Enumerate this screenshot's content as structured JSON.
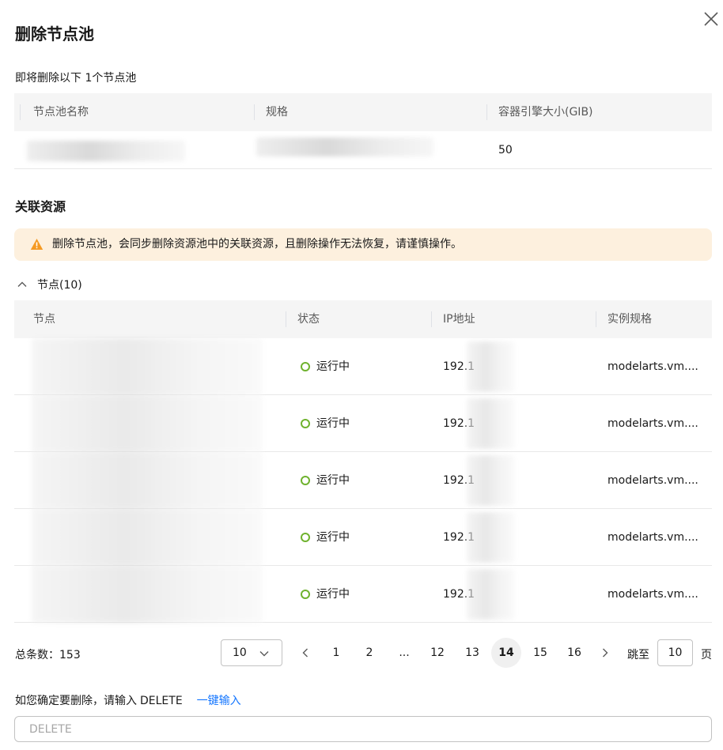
{
  "dialog": {
    "title": "删除节点池",
    "intro": "即将删除以下 1个节点池"
  },
  "pool_table": {
    "headers": [
      "节点池名称",
      "规格",
      "容器引擎大小(GIB)"
    ],
    "rows": [
      {
        "engine_size": "50"
      }
    ]
  },
  "related": {
    "title": "关联资源",
    "alert": "删除节点池，会同步删除资源池中的关联资源，且删除操作无法恢复，请谨慎操作。",
    "nodes_label": "节点(10)"
  },
  "node_table": {
    "headers": [
      "节点",
      "状态",
      "IP地址",
      "实例规格"
    ],
    "rows": [
      {
        "status": "运行中",
        "ip": "192.1",
        "spec": "modelarts.vm...."
      },
      {
        "status": "运行中",
        "ip": "192.1",
        "spec": "modelarts.vm...."
      },
      {
        "status": "运行中",
        "ip": "192.1",
        "spec": "modelarts.vm...."
      },
      {
        "status": "运行中",
        "ip": "192.1",
        "spec": "modelarts.vm...."
      },
      {
        "status": "运行中",
        "ip": "192.1",
        "spec": "modelarts.vm...."
      }
    ]
  },
  "pagination": {
    "total": "总条数：153",
    "page_size": "10",
    "pages": [
      "1",
      "2",
      "...",
      "12",
      "13",
      "14",
      "15",
      "16"
    ],
    "current": "14",
    "jump_label": "跳至",
    "jump_value": "10",
    "jump_suffix": "页"
  },
  "confirm": {
    "prompt": "如您确定要删除，请输入",
    "keyword": "DELETE",
    "quick_input": "一键输入",
    "placeholder": "DELETE"
  },
  "colors": {
    "status_running": "#6fb22e",
    "alert_bg": "#fdf0de",
    "warning_icon": "#f59a23",
    "link": "#1476ff"
  },
  "icons": {
    "close": "close-icon",
    "warning": "warning-icon",
    "collapse": "chevron-up-icon",
    "page_size": "chevron-down-icon",
    "prev": "chevron-left-icon",
    "next": "chevron-right-icon"
  }
}
